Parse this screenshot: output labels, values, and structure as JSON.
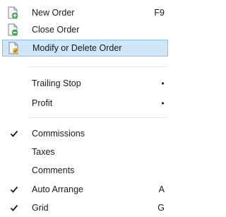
{
  "menu": {
    "items": [
      {
        "label": "New Order",
        "shortcut": "F9",
        "icon": "new-order-icon"
      },
      {
        "label": "Close Order",
        "icon": "close-order-icon"
      },
      {
        "label": "Modify or Delete Order",
        "icon": "modify-order-icon",
        "highlighted": true
      },
      {
        "label": "Trailing Stop",
        "submenu": true
      },
      {
        "label": "Profit",
        "submenu": true
      },
      {
        "label": "Commissions",
        "checked": true
      },
      {
        "label": "Taxes",
        "checked": false
      },
      {
        "label": "Comments",
        "checked": false
      },
      {
        "label": "Auto Arrange",
        "shortcut": "A",
        "checked": true
      },
      {
        "label": "Grid",
        "shortcut": "G",
        "checked": true
      }
    ]
  },
  "colors": {
    "highlight_bg": "#cfe6f8",
    "highlight_border": "#8cc2ea",
    "icon_green": "#3aa845",
    "icon_yellow": "#e8b84a"
  }
}
